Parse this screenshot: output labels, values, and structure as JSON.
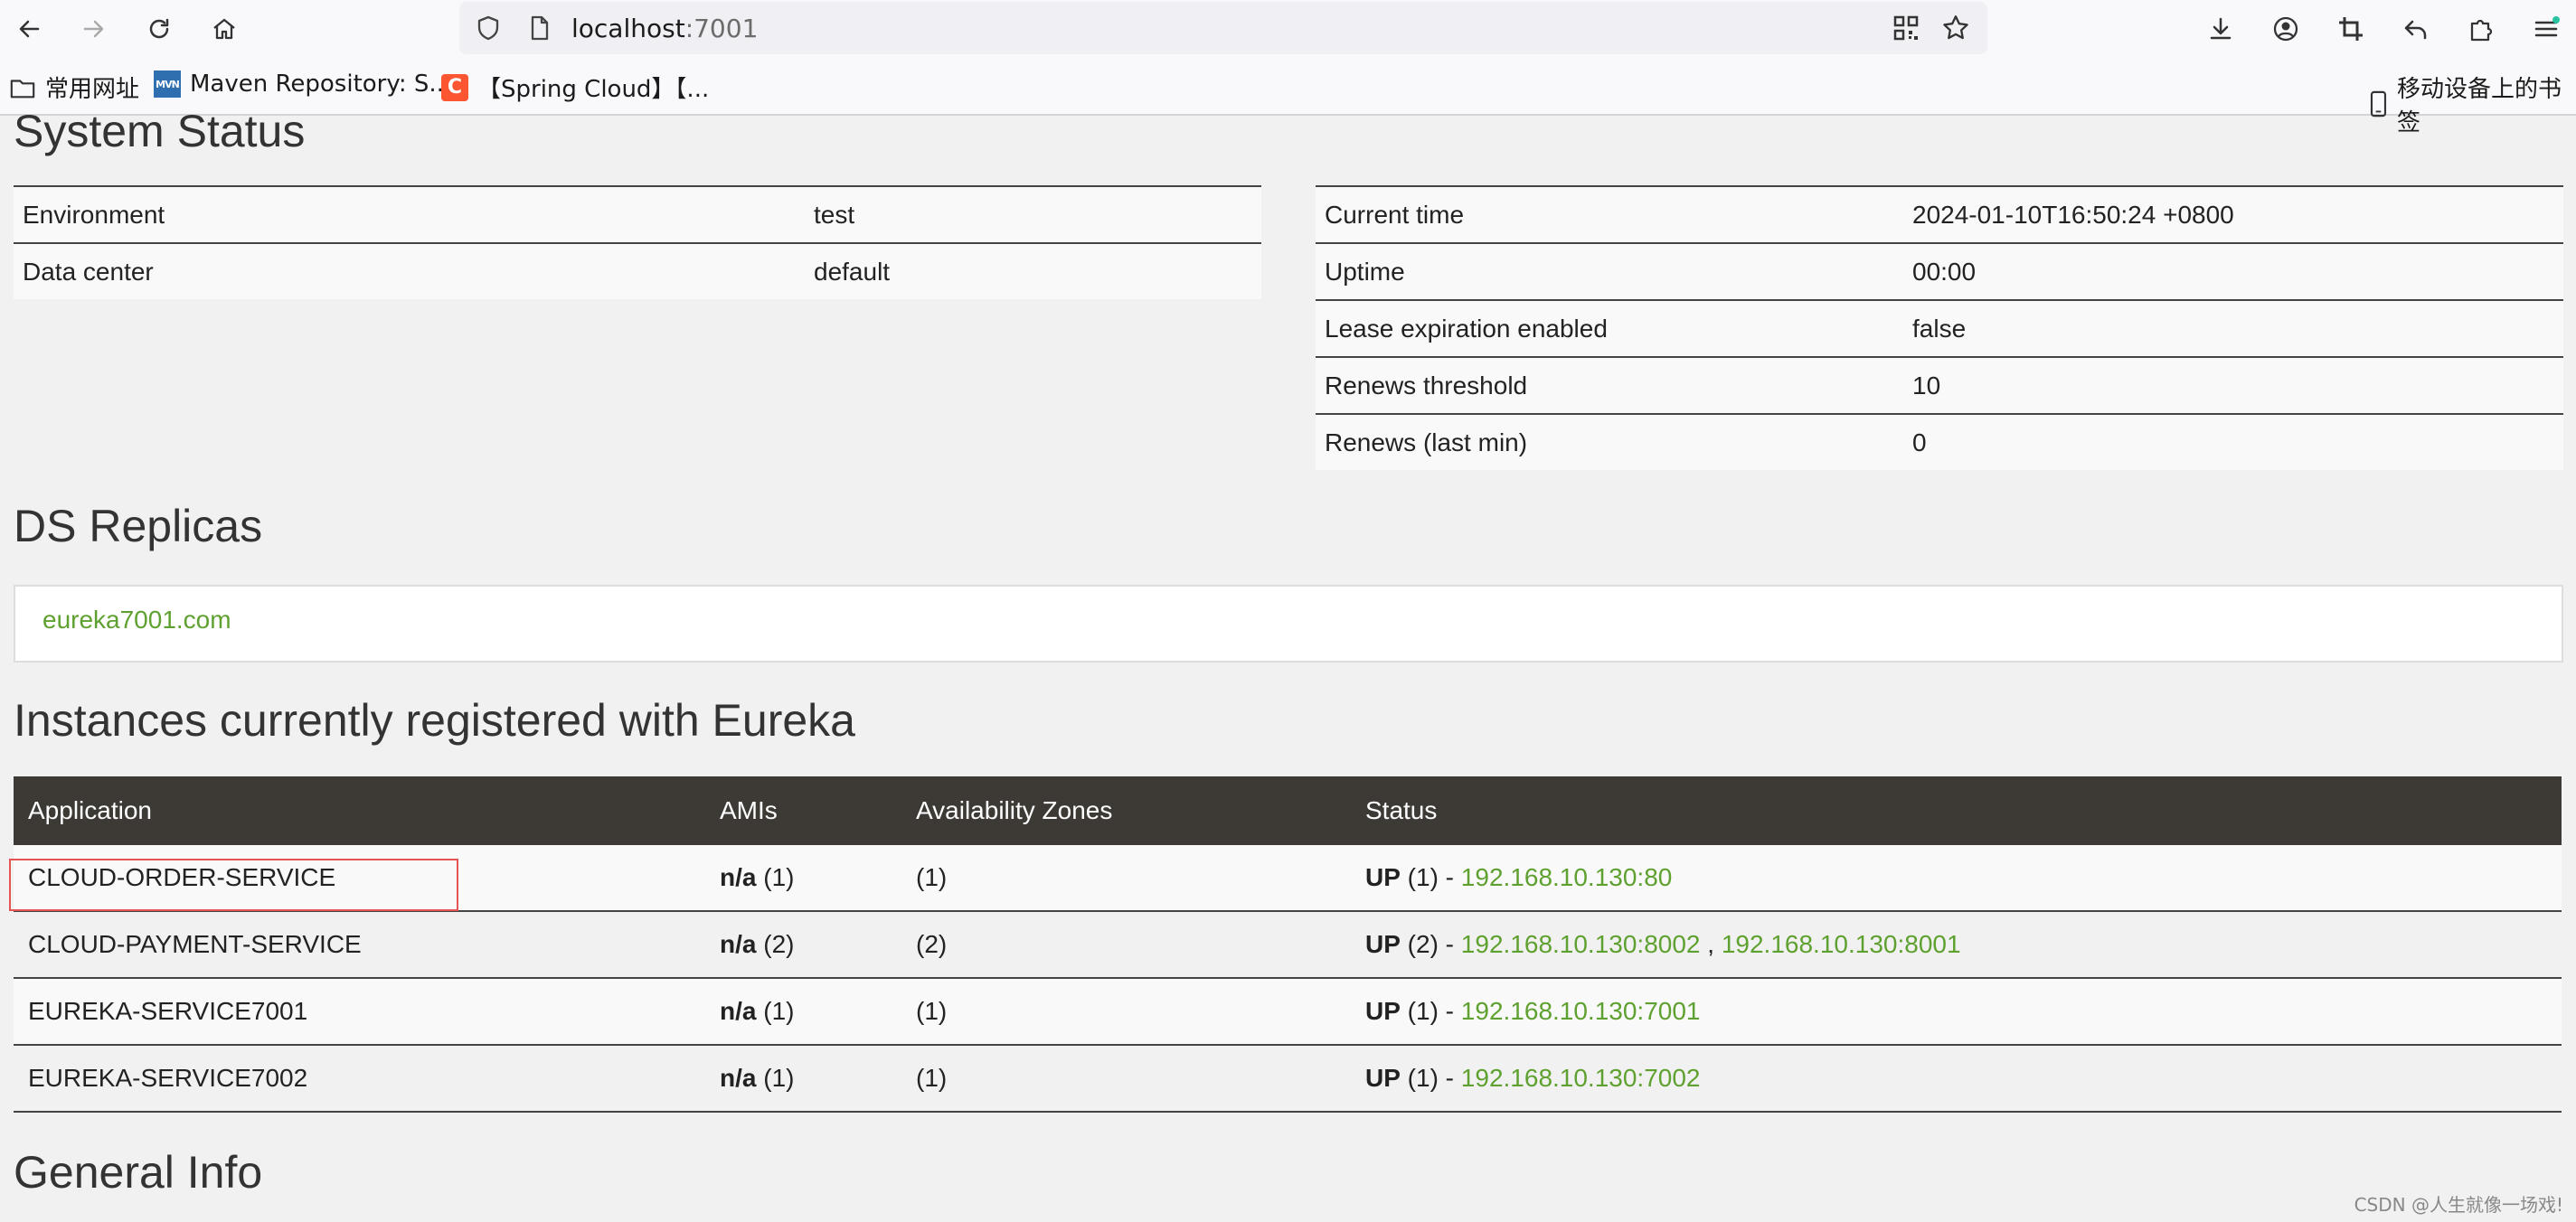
{
  "browser": {
    "url_host": "localhost",
    "url_port": ":7001",
    "bookmarks": [
      "常用网址",
      "Maven Repository: S...",
      "【Spring Cloud】【..."
    ],
    "mobile_bookmarks": "移动设备上的书签"
  },
  "system_status": {
    "title": "System Status",
    "left": [
      {
        "label": "Environment",
        "value": "test"
      },
      {
        "label": "Data center",
        "value": "default"
      }
    ],
    "right": [
      {
        "label": "Current time",
        "value": "2024-01-10T16:50:24 +0800"
      },
      {
        "label": "Uptime",
        "value": "00:00"
      },
      {
        "label": "Lease expiration enabled",
        "value": "false"
      },
      {
        "label": "Renews threshold",
        "value": "10"
      },
      {
        "label": "Renews (last min)",
        "value": "0"
      }
    ]
  },
  "ds_replicas": {
    "title": "DS Replicas",
    "link": "eureka7001.com"
  },
  "instances": {
    "title": "Instances currently registered with Eureka",
    "headers": [
      "Application",
      "AMIs",
      "Availability Zones",
      "Status"
    ],
    "rows": [
      {
        "app": "CLOUD-ORDER-SERVICE",
        "ami_na": "n/a",
        "ami_count": " (1)",
        "zones": "(1)",
        "status_prefix": "UP",
        "status_count": " (1) - ",
        "links": [
          "192.168.10.130:80"
        ],
        "sep": ""
      },
      {
        "app": "CLOUD-PAYMENT-SERVICE",
        "ami_na": "n/a",
        "ami_count": " (2)",
        "zones": "(2)",
        "status_prefix": "UP",
        "status_count": " (2) - ",
        "links": [
          "192.168.10.130:8002",
          "192.168.10.130:8001"
        ],
        "sep": " , "
      },
      {
        "app": "EUREKA-SERVICE7001",
        "ami_na": "n/a",
        "ami_count": " (1)",
        "zones": "(1)",
        "status_prefix": "UP",
        "status_count": " (1) - ",
        "links": [
          "192.168.10.130:7001"
        ],
        "sep": ""
      },
      {
        "app": "EUREKA-SERVICE7002",
        "ami_na": "n/a",
        "ami_count": " (1)",
        "zones": "(1)",
        "status_prefix": "UP",
        "status_count": " (1) - ",
        "links": [
          "192.168.10.130:7002"
        ],
        "sep": ""
      }
    ]
  },
  "general_info": {
    "title": "General Info"
  },
  "watermark": "CSDN @人生就像一场戏!",
  "colors": {
    "link_green": "#5fa130",
    "table_header_bg": "#3d3a35",
    "highlight_red": "#e55353"
  }
}
